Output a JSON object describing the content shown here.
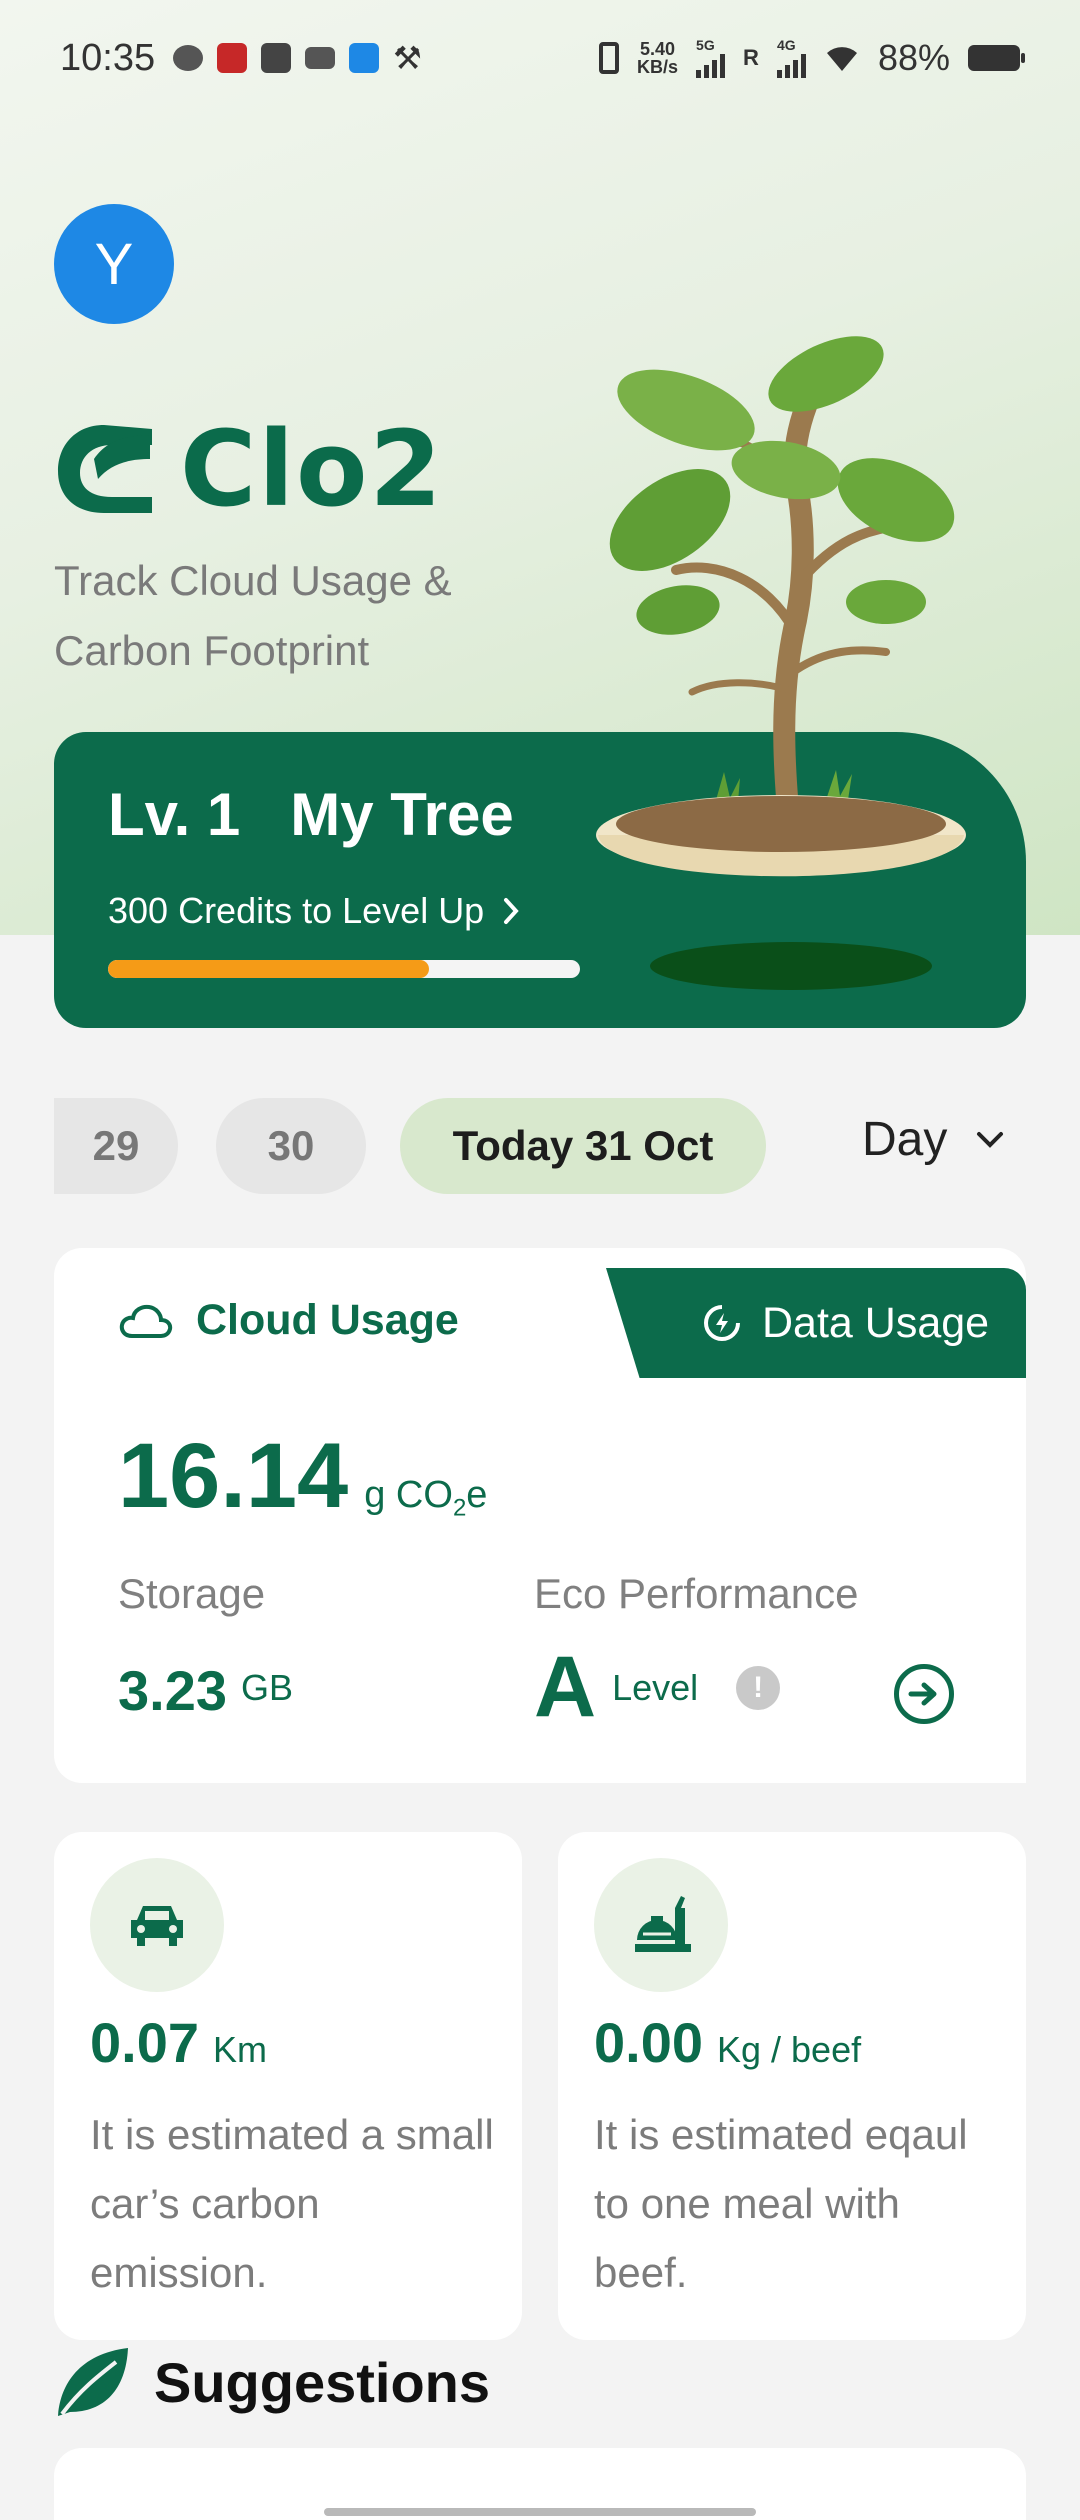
{
  "status_bar": {
    "time": "10:35",
    "net_speed_value": "5.40",
    "net_speed_unit": "KB/s",
    "signal1_label": "5G",
    "signal2_label": "4G",
    "roaming": "R",
    "battery": "88%"
  },
  "profile": {
    "avatar_letter": "Y",
    "avatar_color": "#1e88e5"
  },
  "brand": {
    "name": "Clo2",
    "tagline": "Track Cloud Usage & Carbon Footprint",
    "color": "#0c6b4b"
  },
  "level_card": {
    "level": "Lv. 1",
    "title": "My Tree",
    "subtitle": "300 Credits to Level Up",
    "progress": 0.68,
    "progress_color": "#f59b17"
  },
  "dates": {
    "items": [
      "29",
      "30",
      "Today 31 Oct"
    ],
    "selected": "Today 31 Oct",
    "range": "Day"
  },
  "usage": {
    "tabs": [
      {
        "label": "Cloud Usage",
        "icon": "cloud-icon",
        "active": true
      },
      {
        "label": "Data Usage",
        "icon": "eco-data-icon",
        "active": false
      }
    ],
    "co2_value": "16.14",
    "co2_unit_prefix": "g CO",
    "co2_unit_sub": "2",
    "co2_unit_suffix": "e",
    "storage_label": "Storage",
    "storage_value": "3.23",
    "storage_unit": "GB",
    "eco_label": "Eco Performance",
    "eco_grade": "A",
    "eco_level": "Level",
    "info_icon_text": "!"
  },
  "equivalents": [
    {
      "icon": "car-icon",
      "value": "0.07",
      "unit": "Km",
      "desc": "It is estimated a small car’s carbon emission."
    },
    {
      "icon": "meal-icon",
      "value": "0.00",
      "unit": "Kg / beef",
      "desc": "It is estimated eqaul to one meal with beef."
    }
  ],
  "suggestions": {
    "title": "Suggestions",
    "icon": "leaf-icon"
  }
}
